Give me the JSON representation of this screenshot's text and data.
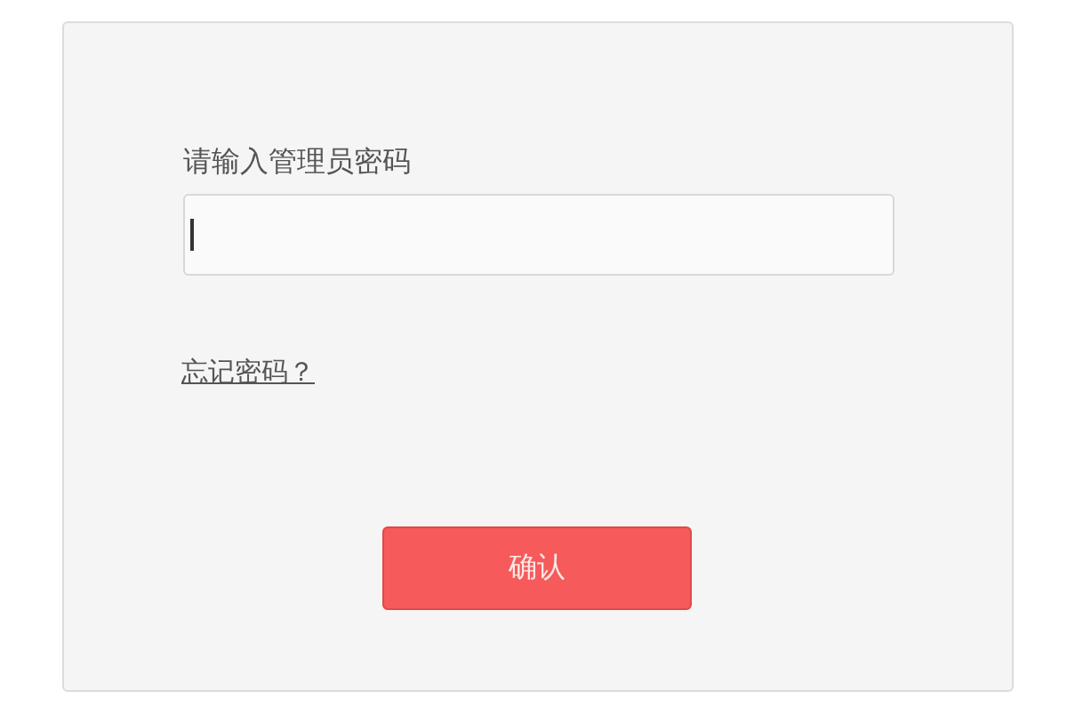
{
  "login": {
    "label": "请输入管理员密码",
    "password_field": {
      "focused": true
    },
    "forgot_link": "忘记密码？",
    "confirm_button": "确认"
  }
}
